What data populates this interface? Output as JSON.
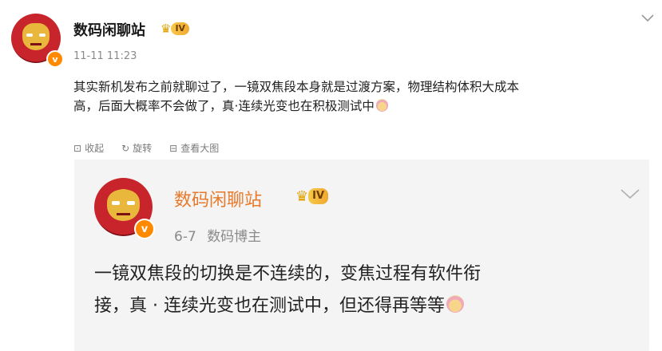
{
  "post": {
    "author": "数码闲聊站",
    "level_badge": "IV",
    "verified_mark": "v",
    "timestamp": "11-11 11:23",
    "text_line1": "其实新机发布之前就聊过了，一镜双焦段本身就是过渡方案，物理结构体积大成本",
    "text_line2": "高，后面大概率不会做了，真·连续光变也在积极测试中",
    "actions": {
      "collapse": "收起",
      "repost": "旋转",
      "view_image": "查看大图"
    }
  },
  "quoted": {
    "author": "数码闲聊站",
    "level_badge": "IV",
    "verified_mark": "v",
    "date": "6-7",
    "role": "数码博主",
    "text_line1": "一镜双焦段的切换是不连续的，变焦过程有软件衔",
    "text_line2": "接，真 · 连续光变也在测试中，但还得再等等"
  },
  "icons": {
    "chevron": "chevron-down-icon",
    "emoji": "cake-emoji-icon",
    "crown": "crown-icon"
  },
  "colors": {
    "verified_orange": "#ff8a00",
    "badge_gold": "#f7c948",
    "quoted_name": "#e8792a",
    "quoted_bg": "#f4f4f4"
  }
}
